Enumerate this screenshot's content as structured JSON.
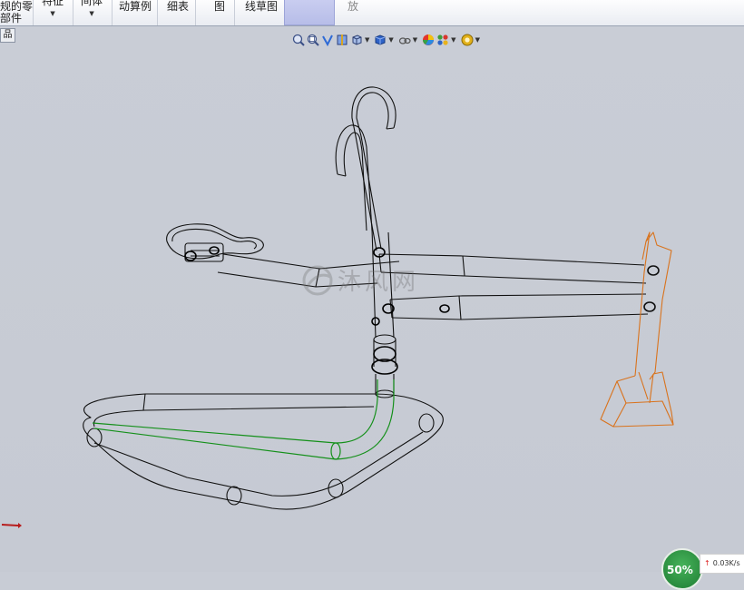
{
  "ribbon": {
    "items": [
      {
        "line1": "规的零",
        "line2": "部件"
      },
      {
        "line1": "特征"
      },
      {
        "line1": "间体"
      },
      {
        "line1": "动算例"
      },
      {
        "line1": "细表"
      },
      {
        "line1": "图"
      },
      {
        "line1": "线草图"
      },
      {
        "line1": "放"
      }
    ]
  },
  "side_tab": "品",
  "heads_up_toolbar": [
    "zoom-to-fit-icon",
    "zoom-to-area-icon",
    "previous-view-icon",
    "section-view-icon",
    "view-orientation-icon",
    "display-style-icon",
    "hide-show-items-icon",
    "edit-appearance-icon",
    "apply-scene-icon",
    "view-settings-icon"
  ],
  "watermark": "沐风网",
  "network_widget": {
    "percent": "50%",
    "speed": "0.03K/s"
  },
  "colors": {
    "selected_green": "#14901a",
    "part_orange": "#d9731d",
    "wire_black": "#111111"
  }
}
